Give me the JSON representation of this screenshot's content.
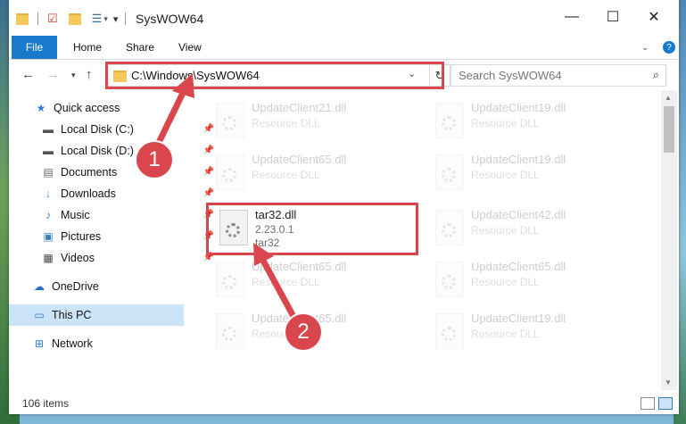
{
  "window": {
    "title": "SysWOW64",
    "controls": {
      "minimize": "—",
      "maximize": "☐",
      "close": "✕"
    },
    "help_icon": "?"
  },
  "ribbon": {
    "tabs": [
      "File",
      "Home",
      "Share",
      "View"
    ]
  },
  "address": {
    "path": "C:\\Windows\\SysWOW64"
  },
  "search": {
    "placeholder": "Search SysWOW64"
  },
  "sidebar": {
    "items": [
      {
        "label": "Quick access",
        "icon": "star-icon"
      },
      {
        "label": "Local Disk (C:)",
        "icon": "drive-icon",
        "pinned": true
      },
      {
        "label": "Local Disk (D:)",
        "icon": "drive-icon",
        "pinned": true
      },
      {
        "label": "Documents",
        "icon": "documents-icon",
        "pinned": true
      },
      {
        "label": "Downloads",
        "icon": "download-icon",
        "pinned": true
      },
      {
        "label": "Music",
        "icon": "music-icon",
        "pinned": true
      },
      {
        "label": "Pictures",
        "icon": "pictures-icon",
        "pinned": true
      },
      {
        "label": "Videos",
        "icon": "videos-icon",
        "pinned": true
      },
      {
        "label": "OneDrive",
        "icon": "cloud-icon"
      },
      {
        "label": "This PC",
        "icon": "computer-icon",
        "selected": true
      },
      {
        "label": "Network",
        "icon": "network-icon"
      }
    ]
  },
  "files": [
    {
      "name": "UpdateClient21.dll",
      "sub1": "Resource DLL"
    },
    {
      "name": "UpdateClient19.dll",
      "sub1": "Resource DLL"
    },
    {
      "name": "UpdateClient65.dll",
      "sub1": "Resource DLL"
    },
    {
      "name": "UpdateClient19.dll",
      "sub1": "Resource DLL"
    },
    {
      "name": "tar32.dll",
      "sub1": "2.23.0.1",
      "sub2": "tar32",
      "highlighted": true
    },
    {
      "name": "UpdateClient42.dll",
      "sub1": "Resource DLL"
    },
    {
      "name": "UpdateClient65.dll",
      "sub1": "Resource DLL"
    },
    {
      "name": "UpdateClient65.dll",
      "sub1": "Resource DLL"
    },
    {
      "name": "UpdateClient65.dll",
      "sub1": "Resource DLL"
    },
    {
      "name": "UpdateClient19.dll",
      "sub1": "Resource DLL"
    }
  ],
  "status": {
    "count": "106 items"
  },
  "annotations": {
    "step1": "1",
    "step2": "2",
    "color": "#d9464c"
  }
}
